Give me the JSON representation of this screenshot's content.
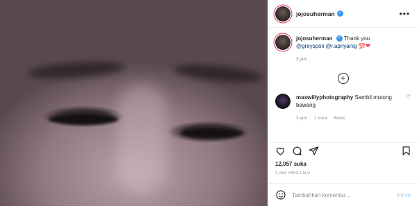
{
  "post": {
    "photo_alt": "photo"
  },
  "header": {
    "username": "jojosuherman",
    "more_label": "•••"
  },
  "comments": [
    {
      "username": "jojosuherman",
      "text_prefix": "Thank you",
      "mention1": "@greyspoii",
      "mention2": "@r.apriyanig",
      "text_suffix": "💯",
      "heart": "❤",
      "time": "3 jam"
    },
    {
      "username": "maxwillyphotography",
      "text": "Sambil motong bawang",
      "time": "3 jam",
      "likes": "1 suka",
      "reply": "Balas"
    }
  ],
  "load_more_label": "+",
  "likes_count": "12,057 suka",
  "timestamp": "3 JAM YANG LALU",
  "add_comment": {
    "placeholder": "Tambahkan komentar...",
    "post_label": "Kirim"
  },
  "colors": {
    "verified": "#3897f0",
    "link": "#00376b",
    "heart": "#ed4956",
    "post_button": "#b2dffc"
  }
}
